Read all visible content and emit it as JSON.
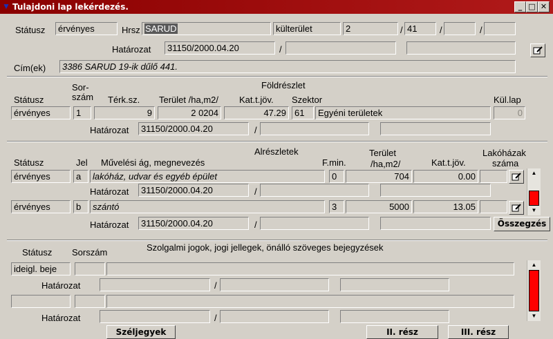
{
  "window": {
    "title": "Tulajdoni lap lekérdezés.",
    "min_glyph": "_",
    "max_glyph": "□",
    "close_glyph": "✕"
  },
  "header": {
    "statusz_label": "Státusz",
    "statusz_value": "érvényes",
    "hrsz_label": "Hrsz",
    "hrsz_value": "SARUD",
    "terulet_tipus": "külterület",
    "hrsz_num1": "2",
    "slash1": "/",
    "hrsz_num2": "41",
    "slash2": "/",
    "slash3": "/",
    "hatarozat_label": "Határozat",
    "hatarozat_value": "31150/2000.04.20",
    "hat_slash": "/",
    "cim_label": "Cím(ek)",
    "cim_value": "3386 SARUD 19-ik dűlő 441."
  },
  "foldreszlet": {
    "title": "Földrészlet",
    "col_statusz": "Státusz",
    "col_sorszam1": "Sor-",
    "col_sorszam2": "szám",
    "col_terksz": "Térk.sz.",
    "col_terulet": "Terület /ha,m2/",
    "col_katjov": "Kat.t.jöv.",
    "col_szektor": "Szektor",
    "col_kullap": "Kül.lap",
    "statusz": "érvényes",
    "sorszam": "1",
    "terksz": "9",
    "terulet": "2 0204",
    "katjov": "47.29",
    "szektor_kod": "61",
    "szektor_nev": "Egyéni területek",
    "kullap": "0",
    "hatarozat_label": "Határozat",
    "hatarozat_value": "31150/2000.04.20",
    "hat_slash": "/"
  },
  "alreszletek": {
    "title": "Alrészletek",
    "col_statusz": "Státusz",
    "col_jel": "Jel",
    "col_muvag": "Művelési ág,  megnevezés",
    "col_fmin": "F.min.",
    "col_terulet1": "Terület",
    "col_terulet2": "/ha,m2/",
    "col_katjov": "Kat.t.jöv.",
    "col_lakohaz1": "Lakóházak",
    "col_lakohaz2": "száma",
    "rows": [
      {
        "statusz": "érvényes",
        "jel": "a",
        "megnevezes": "lakóház, udvar és egyéb épület",
        "fmin": "0",
        "terulet": "704",
        "katjov": "0.00",
        "hatarozat_label": "Határozat",
        "hatarozat_value": "31150/2000.04.20",
        "hat_slash": "/"
      },
      {
        "statusz": "érvényes",
        "jel": "b",
        "megnevezes": "szántó",
        "fmin": "3",
        "terulet": "5000",
        "katjov": "13.05",
        "hatarozat_label": "Határozat",
        "hatarozat_value": "31150/2000.04.20",
        "hat_slash": "/"
      }
    ],
    "osszegzes_label": "Összegzés"
  },
  "szolgalmi": {
    "title": "Szolgalmi jogok, jogi jellegek, önálló szöveges bejegyzések",
    "col_statusz": "Státusz",
    "col_sorszam": "Sorszám",
    "row1_statusz": "ideigl. beje",
    "hatarozat_label": "Határozat",
    "hat_slash": "/"
  },
  "buttons": {
    "szeljegyek": "Széljegyek",
    "ii_resz": "II. rész",
    "iii_resz": "III. rész"
  },
  "colors": {
    "titlebar": "#8a0000",
    "scroll_thumb": "#ff0000",
    "face": "#d4d0c8"
  },
  "icons": {
    "title": "app-icon",
    "edit": "edit-pencil-icon"
  }
}
